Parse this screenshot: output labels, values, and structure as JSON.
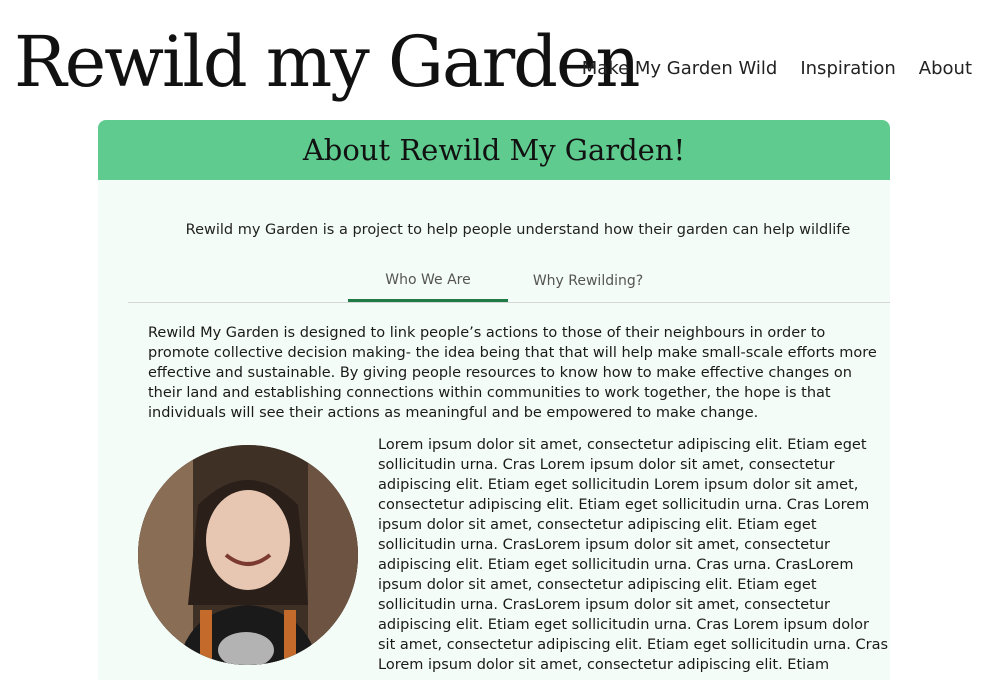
{
  "header": {
    "logo_text": "Rewild my Garden",
    "nav": [
      {
        "label": "Make My Garden Wild"
      },
      {
        "label": "Inspiration"
      },
      {
        "label": "About"
      }
    ]
  },
  "card": {
    "title": "About Rewild My Garden!",
    "intro": "Rewild my Garden is a project to help people understand how their garden can help wildlife",
    "tabs": [
      {
        "label": "Who We Are",
        "active": true
      },
      {
        "label": "Why Rewilding?",
        "active": false
      }
    ],
    "paragraph": "Rewild My Garden is designed to link people’s actions to those of their neighbours in order to promote collective decision making- the idea being that that will help make small-scale efforts more effective and sustainable. By giving people resources to know how to make effective changes on their land and establishing connections within communities to work together, the hope is that individuals will see their actions as meaningful and be empowered to make change.",
    "lorem": "Lorem ipsum dolor sit amet, consectetur adipiscing elit. Etiam eget sollicitudin urna. Cras Lorem ipsum dolor sit amet, consectetur adipiscing elit. Etiam eget sollicitudin Lorem ipsum dolor sit amet, consectetur adipiscing elit. Etiam eget sollicitudin urna. Cras Lorem ipsum dolor sit amet, consectetur adipiscing elit. Etiam eget sollicitudin urna. CrasLorem ipsum dolor sit amet, consectetur adipiscing elit. Etiam eget sollicitudin urna. Cras urna. CrasLorem ipsum dolor sit amet, consectetur adipiscing elit. Etiam eget sollicitudin urna. CrasLorem ipsum dolor sit amet, consectetur adipiscing elit. Etiam eget sollicitudin urna. Cras Lorem ipsum dolor sit amet, consectetur adipiscing elit. Etiam eget sollicitudin urna. Cras Lorem ipsum dolor sit amet, consectetur adipiscing elit. Etiam"
  },
  "colors": {
    "header_green": "#5fcb8f",
    "card_background": "#f4fcf7",
    "active_tab_underline": "#1f7a46"
  }
}
